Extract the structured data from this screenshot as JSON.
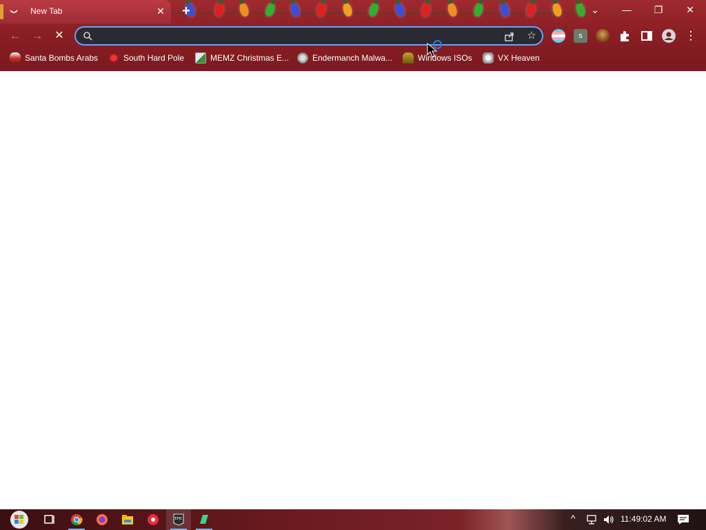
{
  "window": {
    "minimize_label": "—",
    "restore_label": "❐",
    "close_label": "✕",
    "tab_search_label": "⌄"
  },
  "tab": {
    "title": "New Tab",
    "close_label": "✕",
    "new_tab_label": "+"
  },
  "toolbar": {
    "back_label": "←",
    "forward_label": "→",
    "stop_label": "✕",
    "omnibox": {
      "value": "",
      "placeholder": ""
    },
    "star_label": "☆",
    "menu_label": "⋮"
  },
  "bookmarks": [
    {
      "label": "Santa Bombs Arabs",
      "icon": "santa-figure-icon",
      "color": "#c0392b"
    },
    {
      "label": "South Hard Pole",
      "icon": "red-star-icon",
      "color": "#d42020"
    },
    {
      "label": "MEMZ Christmas E...",
      "icon": "memz-icon",
      "color": "#3a8f3a"
    },
    {
      "label": "Endermanch Malwa...",
      "icon": "raccoon-icon",
      "color": "#888888"
    },
    {
      "label": "Windows ISOs",
      "icon": "windows-figure-icon",
      "color": "#c9a227"
    },
    {
      "label": "VX Heaven",
      "icon": "vx-heaven-icon",
      "color": "#bbbbbb"
    }
  ],
  "extensions": [
    {
      "name": "trans-flag-extension-icon",
      "color": "#f5a9b8"
    },
    {
      "name": "s-extension-icon",
      "color": "#6b7a6b"
    },
    {
      "name": "avatar-extension-icon",
      "color": "#c48a3a"
    },
    {
      "name": "puzzle-icon",
      "color": "#ffffff"
    },
    {
      "name": "side-panel-icon",
      "color": "#ffffff"
    },
    {
      "name": "profile-icon",
      "color": "#d0d0d0"
    }
  ],
  "taskbar": {
    "apps": [
      {
        "name": "start-button"
      },
      {
        "name": "task-view-icon"
      },
      {
        "name": "chrome-icon"
      },
      {
        "name": "firefox-icon"
      },
      {
        "name": "file-explorer-icon"
      },
      {
        "name": "red-app-icon"
      },
      {
        "name": "epic-games-icon"
      },
      {
        "name": "green-app-icon"
      }
    ],
    "clock": "11:49:02 AM",
    "chevron_label": "^"
  },
  "colors": {
    "accent": "#6ea2f5",
    "chrome_bg": "#8a1f25",
    "omnibox_bg": "#2a2a32"
  }
}
